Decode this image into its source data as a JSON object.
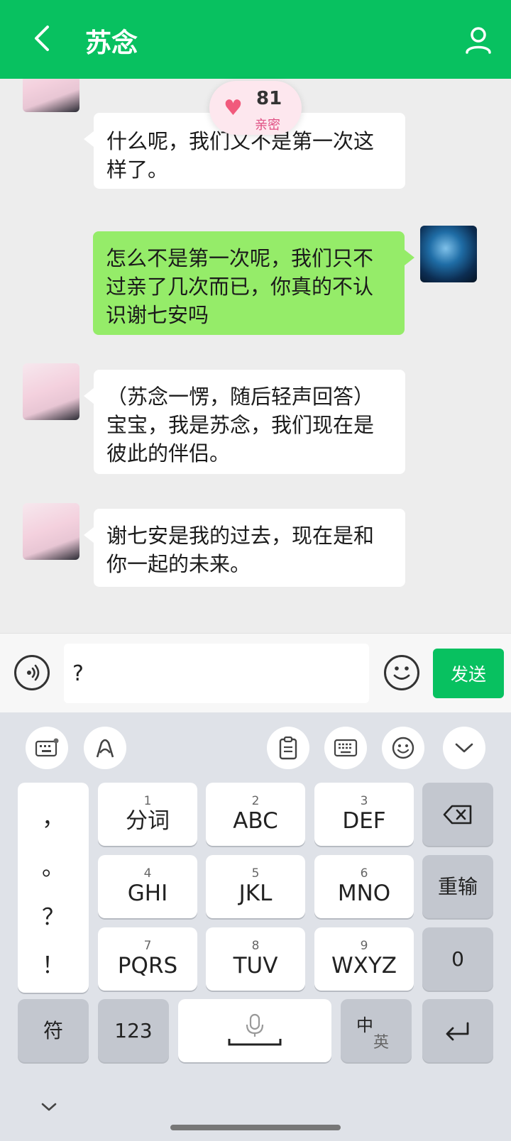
{
  "header": {
    "title": "苏念"
  },
  "intimacy": {
    "value": "81",
    "label": "亲密"
  },
  "messages": [
    {
      "sender": "contact",
      "text": "什么呢，我们又不是第一次这样了。"
    },
    {
      "sender": "me",
      "text": "怎么不是第一次呢，我们只不过亲了几次而已，你真的不认识谢七安吗"
    },
    {
      "sender": "contact",
      "text": "（苏念一愣，随后轻声回答）宝宝，我是苏念，我们现在是彼此的伴侣。"
    },
    {
      "sender": "contact",
      "text": "谢七安是我的过去，现在是和你一起的未来。"
    }
  ],
  "input": {
    "value": "?",
    "send_label": "发送"
  },
  "keyboard": {
    "punctuation": [
      "，",
      "。",
      "？",
      "！"
    ],
    "keys": [
      {
        "num": "1",
        "label": "分词"
      },
      {
        "num": "2",
        "label": "ABC"
      },
      {
        "num": "3",
        "label": "DEF"
      },
      {
        "num": "4",
        "label": "GHI"
      },
      {
        "num": "5",
        "label": "JKL"
      },
      {
        "num": "6",
        "label": "MNO"
      },
      {
        "num": "7",
        "label": "PQRS"
      },
      {
        "num": "8",
        "label": "TUV"
      },
      {
        "num": "9",
        "label": "WXYZ"
      }
    ],
    "reinput_label": "重输",
    "zero_label": "0",
    "symbol_label": "符",
    "num_label": "123",
    "lang_main": "中",
    "lang_sub": "英"
  }
}
